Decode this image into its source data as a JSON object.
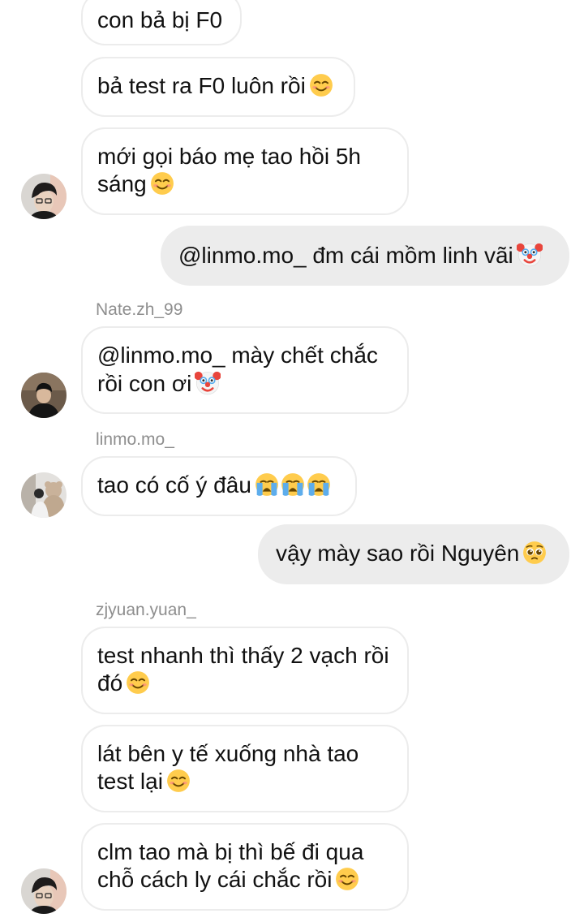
{
  "messages": [
    {
      "text": "con bả bị F0"
    },
    {
      "text": "bả test ra F0 luôn rồi",
      "emoji": "smiling-face-icon"
    },
    {
      "line1": "mới gọi báo mẹ tao hồi 5h",
      "line2": "sáng",
      "emoji": "smiling-face-icon"
    },
    {
      "text": "@linmo.mo_ đm cái mồm linh vãi",
      "emoji": "clown-face-icon"
    },
    {
      "sender": "Nate.zh_99",
      "line1": "@linmo.mo_ mày chết chắc",
      "line2": "rồi con ơi",
      "emoji": "clown-face-icon"
    },
    {
      "sender": "linmo.mo_",
      "text": "tao có cố ý đâu",
      "emoji": "loudly-crying-face-icon x3"
    },
    {
      "text": "vậy mày sao rồi Nguyên",
      "emoji": "pleading-face-icon"
    },
    {
      "sender": "zjyuan.yuan_",
      "line1": "test nhanh thì thấy 2 vạch rồi",
      "line2": "đó",
      "emoji": "smiling-face-icon"
    },
    {
      "line1": "lát bên y tế xuống nhà tao",
      "line2": "test lại",
      "emoji": "smiling-face-icon"
    },
    {
      "line1": "clm tao mà bị thì bế đi qua",
      "line2": "chỗ cách ly cái chắc rồi",
      "emoji": "smiling-face-icon"
    }
  ],
  "colors": {
    "incoming_border": "#ececec",
    "outgoing_bg": "#ececec",
    "sender_text": "#8e8e8e",
    "text": "#111111"
  }
}
